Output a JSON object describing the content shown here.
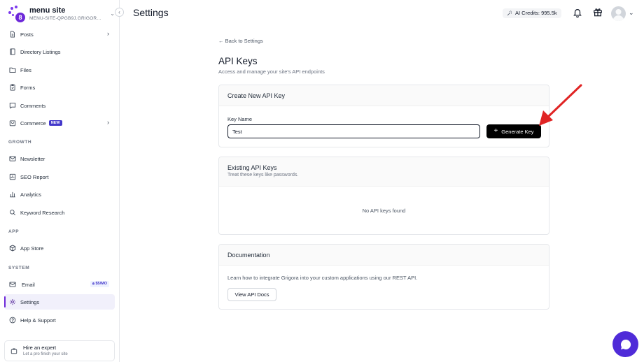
{
  "site": {
    "name": "menu site",
    "slug": "MENU-SITE-QPGB9J.GRIGOR...",
    "logo_badge": "8"
  },
  "sidebar": {
    "items": [
      {
        "id": "posts",
        "label": "Posts",
        "icon": "document-icon",
        "chevron": true
      },
      {
        "id": "directory",
        "label": "Directory Listings",
        "icon": "book-icon"
      },
      {
        "id": "files",
        "label": "Files",
        "icon": "folder-icon"
      },
      {
        "id": "forms",
        "label": "Forms",
        "icon": "clipboard-icon"
      },
      {
        "id": "comments",
        "label": "Comments",
        "icon": "chat-icon"
      },
      {
        "id": "commerce",
        "label": "Commerce",
        "icon": "store-icon",
        "badge": "NEW",
        "chevron": true
      }
    ],
    "sections": {
      "growth": "GROWTH",
      "app": "APP",
      "system": "SYSTEM"
    },
    "growth_items": [
      {
        "label": "Newsletter",
        "icon": "mail-icon"
      },
      {
        "label": "SEO Report",
        "icon": "report-icon"
      },
      {
        "label": "Analytics",
        "icon": "bar-chart-icon"
      },
      {
        "label": "Keyword Research",
        "icon": "search-icon"
      }
    ],
    "app_items": [
      {
        "label": "App Store",
        "icon": "box-icon"
      }
    ],
    "system_items": [
      {
        "label": "Email",
        "icon": "mail-icon",
        "badge": "$5/MO"
      },
      {
        "label": "Settings",
        "icon": "gear-icon",
        "active": true
      },
      {
        "label": "Help & Support",
        "icon": "help-icon"
      }
    ],
    "expert": {
      "title": "Hire an expert",
      "subtitle": "Let a pro finish your site"
    }
  },
  "header": {
    "title": "Settings",
    "credits": "AI Credits: 995.5k"
  },
  "main": {
    "back_label": "← Back to Settings",
    "title": "API Keys",
    "subtitle": "Access and manage your site's API endpoints",
    "create": {
      "title": "Create New API Key",
      "key_label": "Key Name",
      "key_value": "Test",
      "button_label": "Generate Key"
    },
    "existing": {
      "title": "Existing API Keys",
      "desc": "Treat these keys like passwords.",
      "empty": "No API keys found"
    },
    "docs": {
      "title": "Documentation",
      "text": "Learn how to integrate Grigora into your custom applications using our REST API.",
      "button_label": "View API Docs"
    }
  },
  "colors": {
    "accent": "#6d28d9",
    "arrow": "#e02424",
    "chat": "#4f2bd8"
  }
}
